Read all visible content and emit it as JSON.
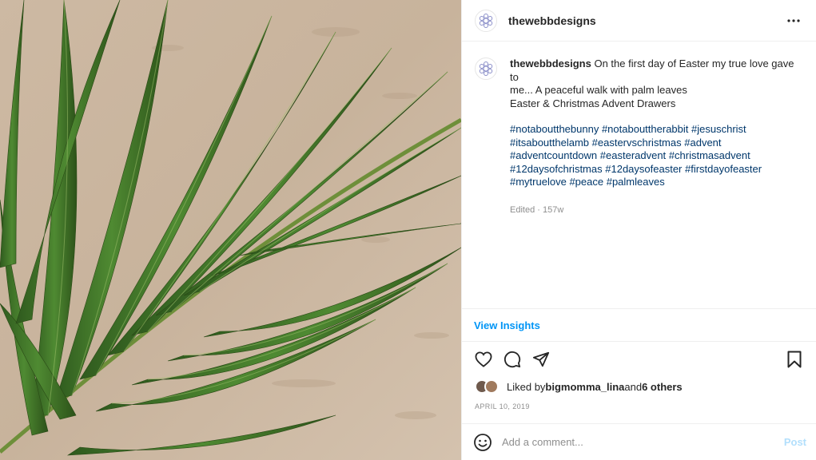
{
  "post": {
    "username": "thewebbdesigns",
    "caption_text_1": " On the first day of Easter my true love gave to",
    "caption_text_2": "me... A peaceful walk with palm leaves",
    "caption_text_3": "Easter & Christmas Advent Drawers",
    "hashtags": [
      "#notaboutthebunny",
      "#notabouttherabbit",
      "#jesuschrist",
      "#itsaboutthelamb",
      "#eastervschristmas",
      "#advent",
      "#adventcountdown",
      "#easteradvent",
      "#christmasadvent",
      "#12daysofchristmas",
      "#12daysofeaster",
      "#firstdayofeaster",
      "#mytruelove",
      "#peace",
      "#palmleaves"
    ],
    "edited_label": "Edited · 157w"
  },
  "insights": {
    "label": "View Insights"
  },
  "likes": {
    "prefix": "Liked by ",
    "user": "bigmomma_lina",
    "middle": " and ",
    "others": "6 others"
  },
  "date": "APRIL 10, 2019",
  "comment": {
    "placeholder": "Add a comment...",
    "post_label": "Post"
  },
  "icons": {
    "more": "more-horizontal-icon",
    "like": "heart-icon",
    "comment": "comment-icon",
    "share": "send-icon",
    "save": "bookmark-icon",
    "emoji": "emoji-icon"
  },
  "colors": {
    "link": "#00376b",
    "accent": "#0095f6",
    "post_disabled": "#b2dffc",
    "muted": "#8e8e8e"
  }
}
